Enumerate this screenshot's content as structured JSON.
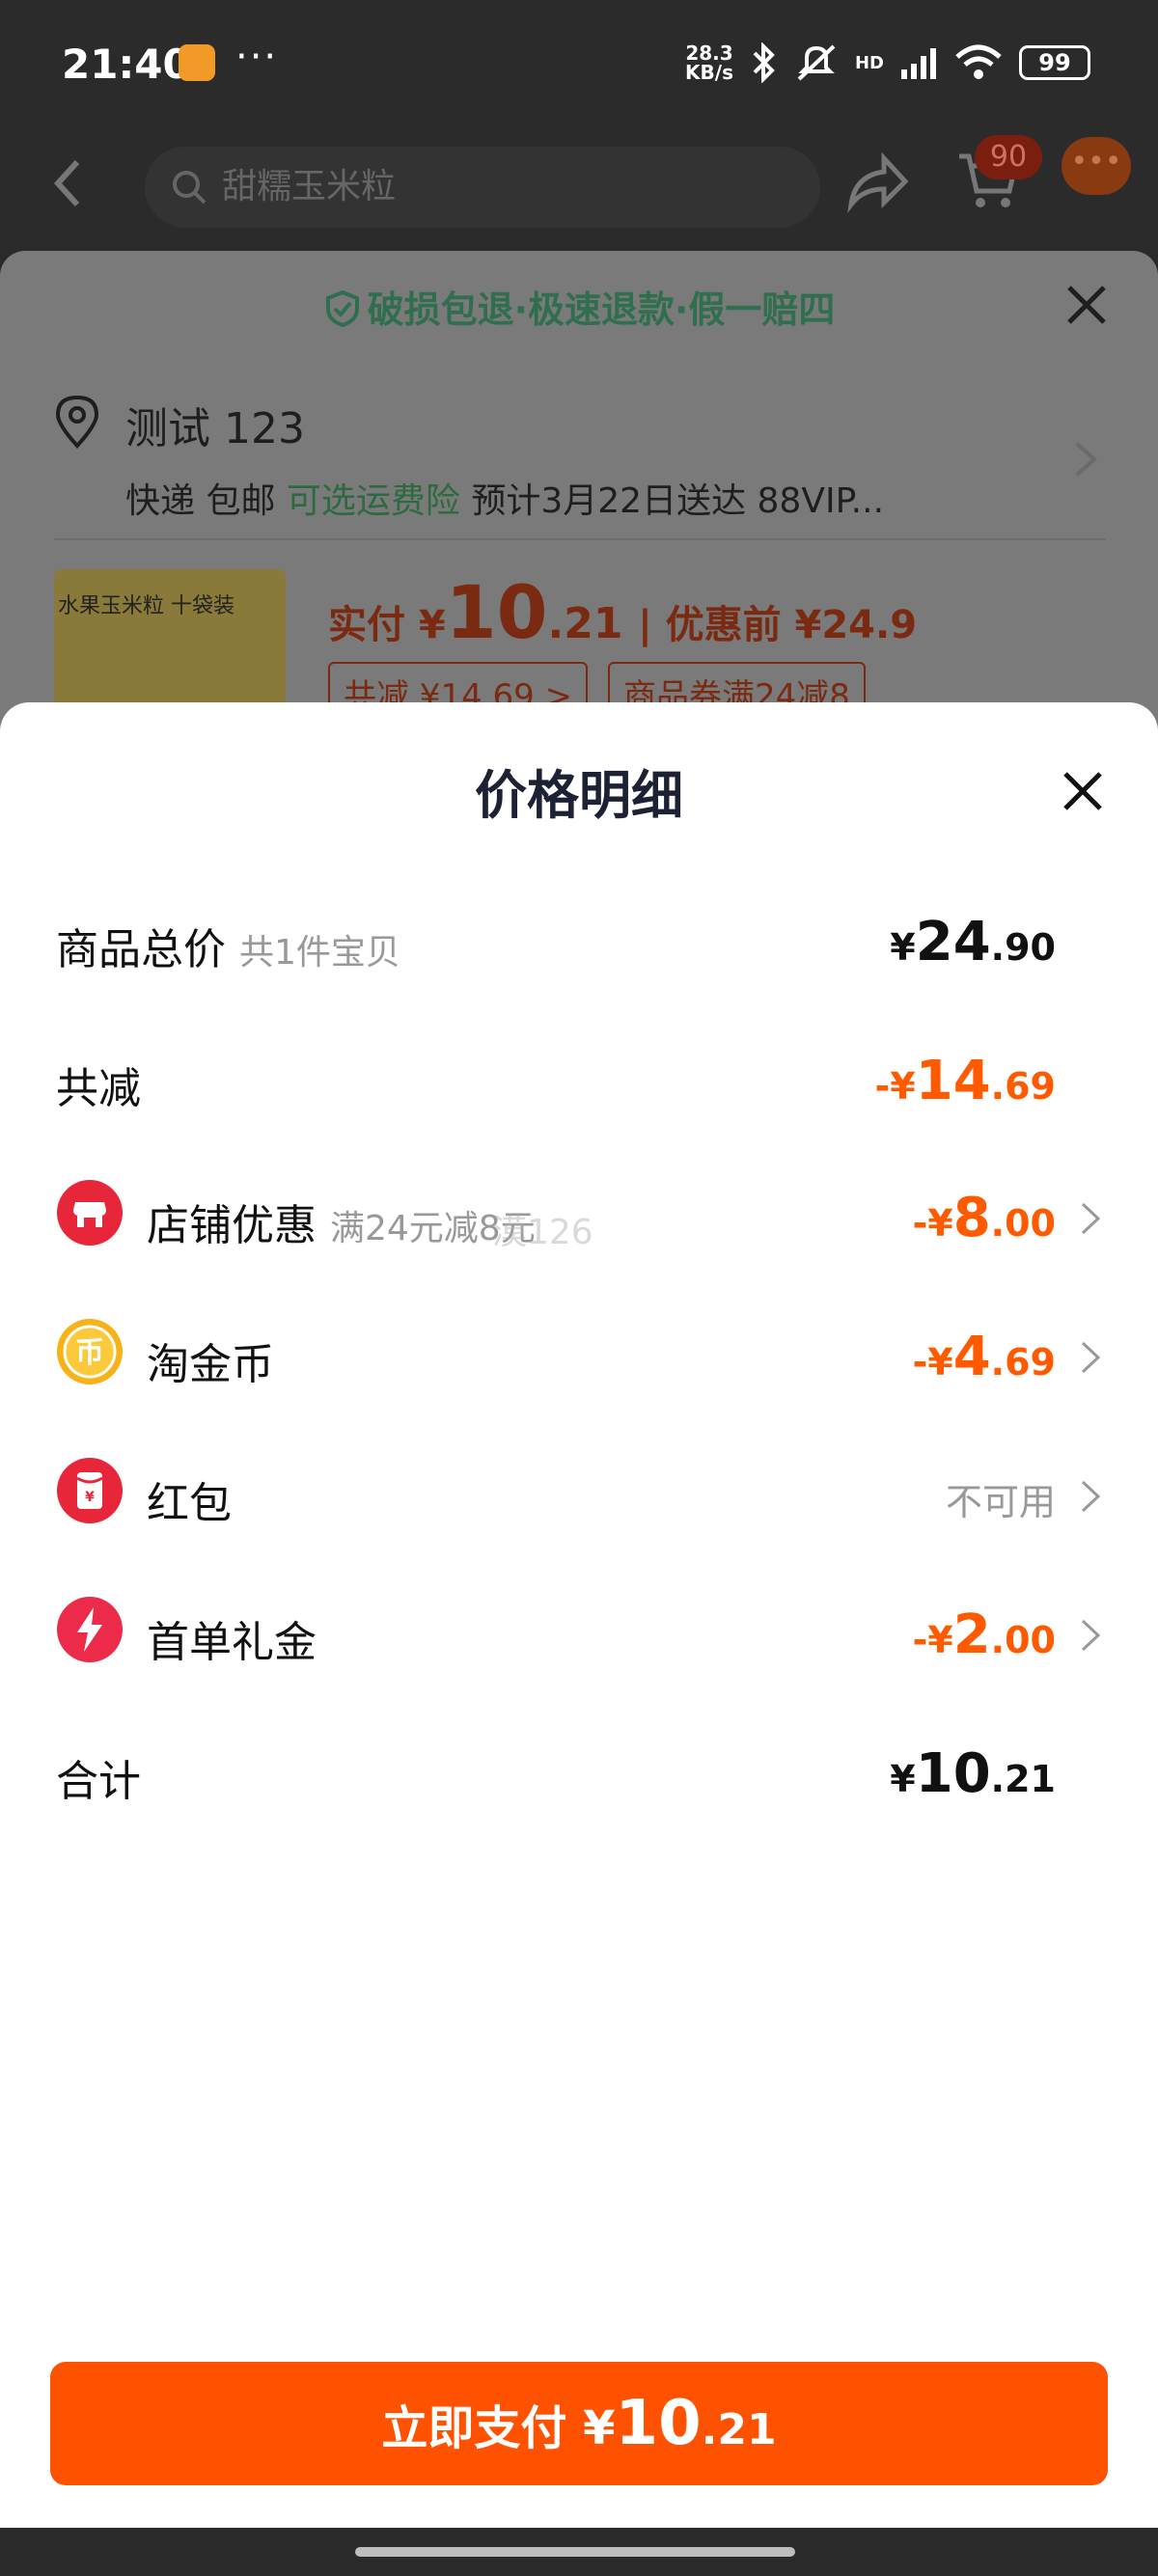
{
  "status_bar": {
    "time": "21:40",
    "dots": "···",
    "net_speed_value": "28.3",
    "net_speed_unit": "KB/s",
    "signal_label": "HD",
    "battery": "99",
    "icons": [
      "app-badge-icon",
      "bluetooth-icon",
      "mute-icon",
      "signal-icon",
      "wifi-icon",
      "battery-icon"
    ]
  },
  "top_nav": {
    "search_placeholder": "甜糯玉米粒",
    "cart_count": "90"
  },
  "background_panel": {
    "guarantee": "破损包退·极速退款·假一赔四",
    "address_name": "测试 123",
    "shipping": {
      "method": "快递 包邮",
      "insurance": "可选运费险",
      "eta": "预计3月22日送达 88VIP..."
    },
    "product_thumb_text": "水果玉米粒 十袋装",
    "price_summary": {
      "paid_label": "实付 ¥",
      "paid_int": "10",
      "paid_dec": ".21",
      "before_label": "| 优惠前 ¥24.9"
    },
    "tags": [
      "共减 ¥14.69 >",
      "商品券满24减8"
    ]
  },
  "sheet": {
    "title": "价格明细",
    "rows": [
      {
        "label": "商品总价",
        "sub": "共1件宝贝",
        "amount_prefix": "¥",
        "amount_int": "24",
        "amount_dec": ".90"
      },
      {
        "label": "共减",
        "amount_prefix": "-¥",
        "amount_int": "14",
        "amount_dec": ".69"
      },
      {
        "label": "店铺优惠",
        "sub": "满24元减8元",
        "amount_prefix": "-¥",
        "amount_int": "8",
        "amount_dec": ".00",
        "icon": "shop-icon"
      },
      {
        "label": "淘金币",
        "amount_prefix": "-¥",
        "amount_int": "4",
        "amount_dec": ".69",
        "icon": "coin-icon"
      },
      {
        "label": "红包",
        "status": "不可用",
        "icon": "red-envelope-icon"
      },
      {
        "label": "首单礼金",
        "amount_prefix": "-¥",
        "amount_int": "2",
        "amount_dec": ".00",
        "icon": "lightning-icon"
      },
      {
        "label": "合计",
        "amount_prefix": "¥",
        "amount_int": "10",
        "amount_dec": ".21"
      }
    ],
    "watermark": "漠126"
  },
  "pay_button": {
    "label": "立即支付 ¥",
    "amount_int": "10",
    "amount_dec": ".21"
  },
  "colors": {
    "accent_orange": "#ff5a00",
    "pay_button": "#ff5200",
    "green": "#2b8a4e"
  }
}
